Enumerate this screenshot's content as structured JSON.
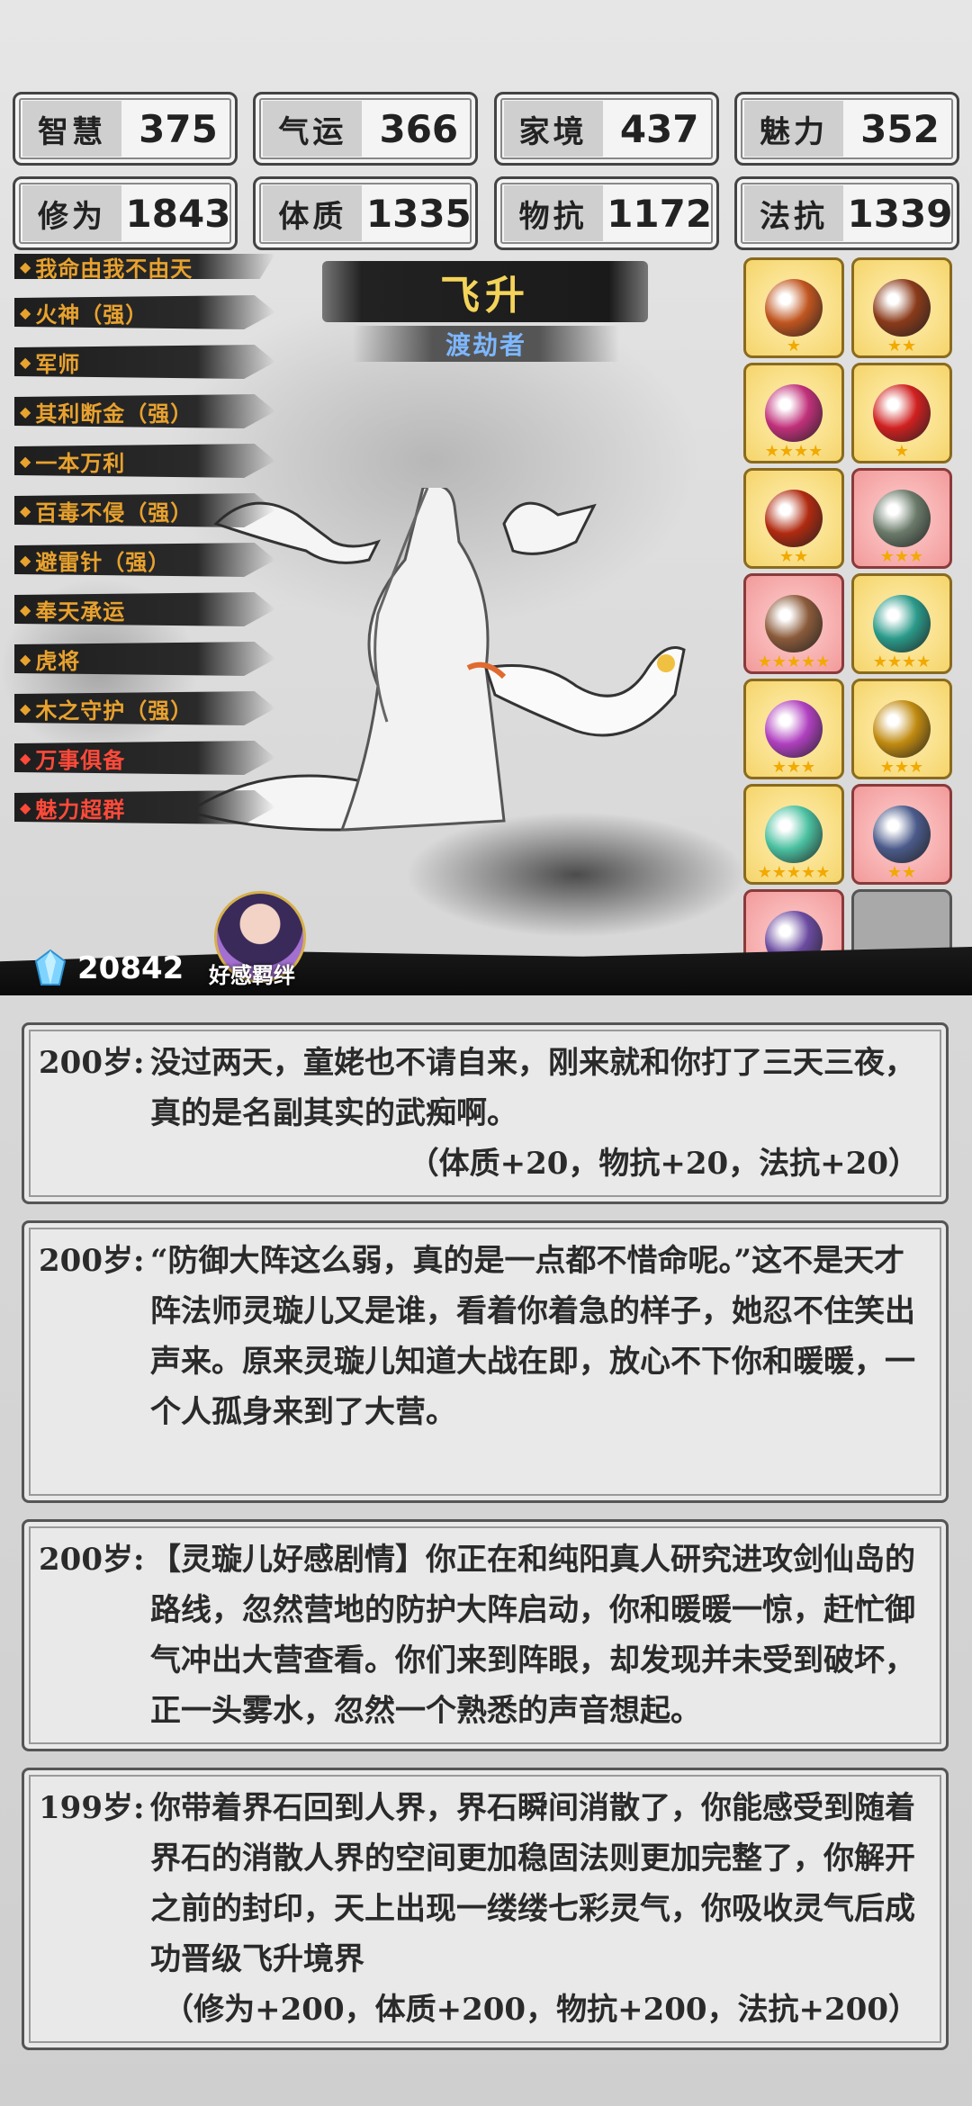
{
  "stats": [
    [
      {
        "label": "智慧",
        "value": "375"
      },
      {
        "label": "气运",
        "value": "366"
      },
      {
        "label": "家境",
        "value": "437"
      },
      {
        "label": "魅力",
        "value": "352"
      }
    ],
    [
      {
        "label": "修为",
        "value": "1843"
      },
      {
        "label": "体质",
        "value": "1335"
      },
      {
        "label": "物抗",
        "value": "1172"
      },
      {
        "label": "法抗",
        "value": "1339"
      }
    ]
  ],
  "traits": [
    {
      "label": "我命由我不由天",
      "color": "gold"
    },
    {
      "label": "火神（强）",
      "color": "gold"
    },
    {
      "label": "军师",
      "color": "gold"
    },
    {
      "label": "其利断金（强）",
      "color": "gold"
    },
    {
      "label": "一本万利",
      "color": "gold"
    },
    {
      "label": "百毒不侵（强）",
      "color": "gold"
    },
    {
      "label": "避雷针（强）",
      "color": "gold"
    },
    {
      "label": "奉天承运",
      "color": "gold"
    },
    {
      "label": "虎将",
      "color": "gold"
    },
    {
      "label": "木之守护（强）",
      "color": "gold"
    },
    {
      "label": "万事俱备",
      "color": "red"
    },
    {
      "label": "魅力超群",
      "color": "red"
    }
  ],
  "realm": {
    "title": "飞升",
    "subtitle": "渡劫者"
  },
  "items": [
    {
      "name": "bronze-cauldron-icon",
      "bg": "gold",
      "stars": "★",
      "color": "#c0551f"
    },
    {
      "name": "war-fan-icon",
      "bg": "gold",
      "stars": "★★",
      "color": "#8a3a1a"
    },
    {
      "name": "pink-censer-icon",
      "bg": "gold",
      "stars": "★★★★",
      "color": "#c0307a"
    },
    {
      "name": "fire-orb-icon",
      "bg": "gold",
      "stars": "★",
      "color": "#d02020"
    },
    {
      "name": "red-boots-icon",
      "bg": "gold",
      "stars": "★★",
      "color": "#b02a10"
    },
    {
      "name": "halberd-icon",
      "bg": "pink",
      "stars": "★★★",
      "color": "#6a7a6a"
    },
    {
      "name": "bronze-sword-icon",
      "bg": "pink",
      "stars": "★★★★★",
      "color": "#8a5a3a"
    },
    {
      "name": "jade-sword-icon",
      "bg": "gold",
      "stars": "★★★★",
      "color": "#2a9a8a"
    },
    {
      "name": "purple-teapot-icon",
      "bg": "gold",
      "stars": "★★★",
      "color": "#b040c0"
    },
    {
      "name": "gold-ring-icon",
      "bg": "gold",
      "stars": "★★★",
      "color": "#c08a10"
    },
    {
      "name": "rainbow-crystal-icon",
      "bg": "gold",
      "stars": "★★★★★",
      "color": "#4ac0a0"
    },
    {
      "name": "dark-spear-icon",
      "bg": "pink",
      "stars": "★★",
      "color": "#4a5a8a"
    },
    {
      "name": "mystic-mirror-icon",
      "bg": "pink",
      "stars": "★★★★★",
      "color": "#6a4aa0"
    },
    {
      "name": "empty-slot",
      "bg": "empty",
      "stars": "",
      "color": ""
    }
  ],
  "crystals": "20842",
  "affection_label": "好感羁绊",
  "log": [
    {
      "age": "200岁:",
      "text": "没过两天，童姥也不请自来，刚来就和你打了三天三夜，真的是名副其实的武痴啊。",
      "effect": "（体质+20，物抗+20，法抗+20）"
    },
    {
      "age": "200岁:",
      "text": "“防御大阵这么弱，真的是一点都不惜命呢。”这不是天才阵法师灵璇儿又是谁，看着你着急的样子，她忍不住笑出声来。原来灵璇儿知道大战在即，放心不下你和暖暖，一个人孤身来到了大营。",
      "effect": ""
    },
    {
      "age": "200岁:",
      "text": "【灵璇儿好感剧情】你正在和纯阳真人研究进攻剑仙岛的路线，忽然营地的防护大阵启动，你和暖暖一惊，赶忙御气冲出大营查看。你们来到阵眼，却发现并未受到破坏，正一头雾水，忽然一个熟悉的声音想起。",
      "effect": ""
    },
    {
      "age": "199岁:",
      "text": "你带着界石回到人界，界石瞬间消散了，你能感受到随着界石的消散人界的空间更加稳固法则更加完整了，你解开之前的封印，天上出现一缕缕七彩灵气，你吸收灵气后成功晋级飞升境界",
      "effect": "（修为+200，体质+200，物抗+200，法抗+200）"
    }
  ]
}
